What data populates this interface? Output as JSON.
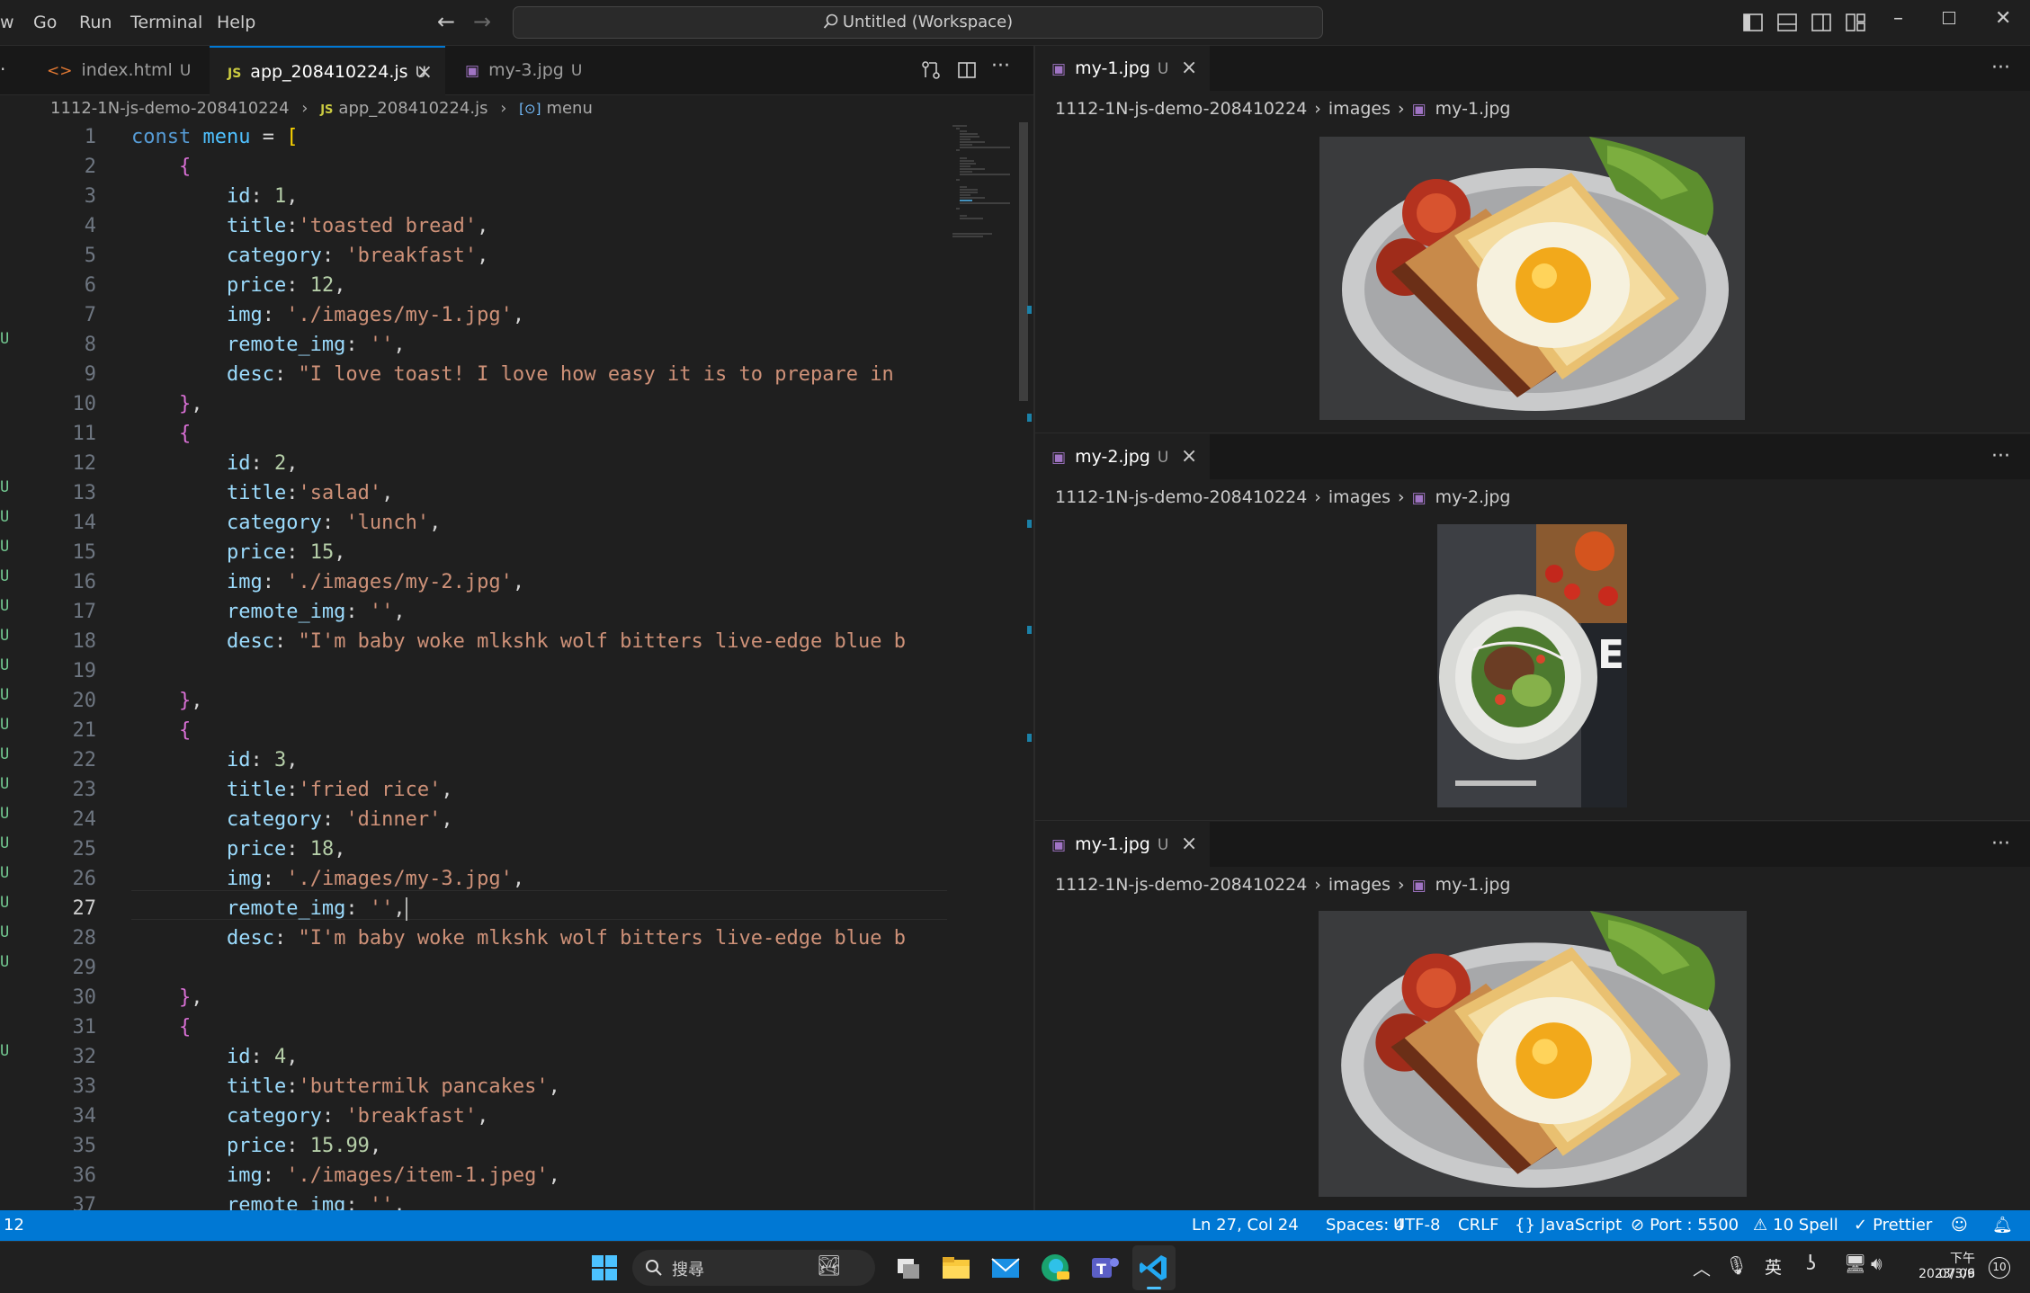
{
  "menu": {
    "items": [
      "w",
      "Go",
      "Run",
      "Terminal",
      "Help"
    ]
  },
  "titlebar": {
    "search_text": "Untitled (Workspace)"
  },
  "left_tabs": [
    {
      "label": "index.html",
      "status": "U"
    },
    {
      "label": "app_208410224.js",
      "status": "U"
    },
    {
      "label": "my-3.jpg",
      "status": "U"
    }
  ],
  "left_breadcrumb": {
    "folder": "1112-1N-js-demo-208410224",
    "file": "app_208410224.js",
    "symbol": "menu"
  },
  "gutter_marks": [
    "U",
    "U",
    "U",
    "U",
    "U",
    "U",
    "U",
    "U",
    "U",
    "U",
    "U",
    "U",
    "U",
    "U",
    "U",
    "U",
    "U",
    "U",
    "U"
  ],
  "code": {
    "current_line": 27,
    "lines": [
      {
        "n": "1",
        "t": "const menu = ["
      },
      {
        "n": "2",
        "t": "    {"
      },
      {
        "n": "3",
        "t": "        id: 1,"
      },
      {
        "n": "4",
        "t": "        title:'toasted bread',"
      },
      {
        "n": "5",
        "t": "        category: 'breakfast',"
      },
      {
        "n": "6",
        "t": "        price: 12,"
      },
      {
        "n": "7",
        "t": "        img: './images/my-1.jpg',"
      },
      {
        "n": "8",
        "t": "        remote_img: '',"
      },
      {
        "n": "9",
        "t": "        desc: \"I love toast! I love how easy it is to prepare in"
      },
      {
        "n": "10",
        "t": "    },"
      },
      {
        "n": "11",
        "t": "    {"
      },
      {
        "n": "12",
        "t": "        id: 2,"
      },
      {
        "n": "13",
        "t": "        title:'salad',"
      },
      {
        "n": "14",
        "t": "        category: 'lunch',"
      },
      {
        "n": "15",
        "t": "        price: 15,"
      },
      {
        "n": "16",
        "t": "        img: './images/my-2.jpg',"
      },
      {
        "n": "17",
        "t": "        remote_img: '',"
      },
      {
        "n": "18",
        "t": "        desc: \"I'm baby woke mlkshk wolf bitters live-edge blue b"
      },
      {
        "n": "19",
        "t": ""
      },
      {
        "n": "20",
        "t": "    },"
      },
      {
        "n": "21",
        "t": "    {"
      },
      {
        "n": "22",
        "t": "        id: 3,"
      },
      {
        "n": "23",
        "t": "        title:'fried rice',"
      },
      {
        "n": "24",
        "t": "        category: 'dinner',"
      },
      {
        "n": "25",
        "t": "        price: 18,"
      },
      {
        "n": "26",
        "t": "        img: './images/my-3.jpg',"
      },
      {
        "n": "27",
        "t": "        remote_img: '',"
      },
      {
        "n": "28",
        "t": "        desc: \"I'm baby woke mlkshk wolf bitters live-edge blue b"
      },
      {
        "n": "29",
        "t": ""
      },
      {
        "n": "30",
        "t": "    },"
      },
      {
        "n": "31",
        "t": "    {"
      },
      {
        "n": "32",
        "t": "        id: 4,"
      },
      {
        "n": "33",
        "t": "        title:'buttermilk pancakes',"
      },
      {
        "n": "34",
        "t": "        category: 'breakfast',"
      },
      {
        "n": "35",
        "t": "        price: 15.99,"
      },
      {
        "n": "36",
        "t": "        img: './images/item-1.jpeg',"
      },
      {
        "n": "37",
        "t": "        remote_img: '',"
      }
    ]
  },
  "right_panes": [
    {
      "tab": "my-1.jpg",
      "status": "U",
      "crumb_folder": "1112-1N-js-demo-208410224",
      "crumb_sub": "images",
      "crumb_file": "my-1.jpg"
    },
    {
      "tab": "my-2.jpg",
      "status": "U",
      "crumb_folder": "1112-1N-js-demo-208410224",
      "crumb_sub": "images",
      "crumb_file": "my-2.jpg"
    },
    {
      "tab": "my-1.jpg",
      "status": "U",
      "crumb_folder": "1112-1N-js-demo-208410224",
      "crumb_sub": "images",
      "crumb_file": "my-1.jpg"
    }
  ],
  "statusbar": {
    "left": "12",
    "position": "Ln 27, Col 24",
    "spaces": "Spaces: 4",
    "encoding": "UTF-8",
    "eol": "CRLF",
    "language": "JavaScript",
    "port": "Port : 5500",
    "spell": "10 Spell",
    "prettier": "Prettier"
  },
  "taskbar": {
    "search": "搜尋",
    "ime": "英",
    "time": "下午 07:06",
    "date": "2023/3/9",
    "notifications": "10"
  },
  "colors": {
    "accent": "#0078d4",
    "keyword": "#569cd6",
    "string": "#ce9178",
    "number": "#b5cea8",
    "property": "#9cdcfe",
    "bracket": "#da70d6"
  }
}
